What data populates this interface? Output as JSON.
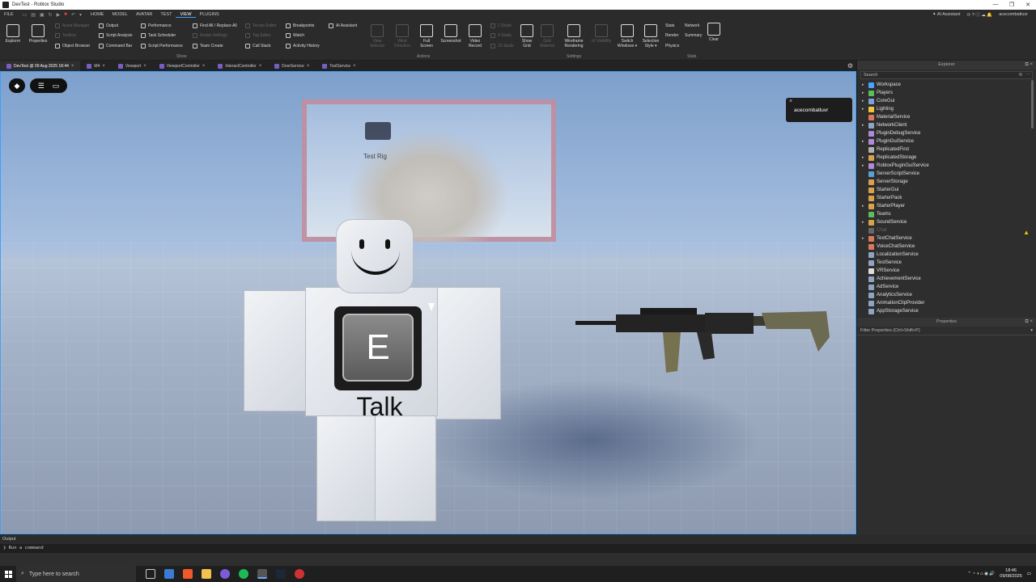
{
  "window": {
    "title": "DevTest - Roblox Studio",
    "controls": [
      "—",
      "❐",
      "✕"
    ]
  },
  "menu": {
    "items": [
      "FILE",
      "HOME",
      "MODEL",
      "AVATAR",
      "TEST",
      "VIEW",
      "PLUGINS"
    ],
    "active": "VIEW",
    "right": {
      "assistant": "AI Assistant",
      "user": "acecombatluvr"
    }
  },
  "ribbon": {
    "big": [
      {
        "label": "Explorer",
        "disabled": false
      },
      {
        "label": "Properties",
        "disabled": false
      }
    ],
    "col1": [
      {
        "label": "Asset Manager",
        "disabled": true
      },
      {
        "label": "Toolbox",
        "disabled": true
      },
      {
        "label": "Object Browser",
        "disabled": false
      }
    ],
    "col2": [
      {
        "label": "Output",
        "disabled": false
      },
      {
        "label": "Script Analysis",
        "disabled": false
      },
      {
        "label": "Command Bar",
        "disabled": false
      }
    ],
    "col3": [
      {
        "label": "Performance",
        "disabled": false
      },
      {
        "label": "Task Scheduler",
        "disabled": false
      },
      {
        "label": "Script Performance",
        "disabled": false
      }
    ],
    "col4": [
      {
        "label": "Find All / Replace All",
        "disabled": false
      },
      {
        "label": "Avatar Settings",
        "disabled": true
      },
      {
        "label": "Team Create",
        "disabled": false
      }
    ],
    "col5": [
      {
        "label": "Terrain Editor",
        "disabled": true
      },
      {
        "label": "Tag Editor",
        "disabled": true
      },
      {
        "label": "Call Stack",
        "disabled": false
      }
    ],
    "col6": [
      {
        "label": "Breakpoints",
        "disabled": false
      },
      {
        "label": "Watch",
        "disabled": false
      },
      {
        "label": "Activity History",
        "disabled": false
      }
    ],
    "col7": [
      {
        "label": "AI Assistant",
        "disabled": false
      }
    ],
    "show_group": "Show",
    "actions": [
      {
        "l1": "View",
        "l2": "Selector",
        "disabled": true
      },
      {
        "l1": "Wind",
        "l2": "Direction",
        "disabled": true
      },
      {
        "l1": "Full",
        "l2": "Screen",
        "disabled": false
      },
      {
        "l1": "Screenshot",
        "l2": "",
        "disabled": false
      },
      {
        "l1": "Video",
        "l2": "Record",
        "disabled": false
      }
    ],
    "studs": [
      "2 Studs",
      "4 Studs",
      "16 Studs"
    ],
    "actions_group": "Actions",
    "settings": [
      {
        "l1": "Show",
        "l2": "Grid",
        "disabled": false
      },
      {
        "l1": "Grid",
        "l2": "Material",
        "disabled": true
      },
      {
        "l1": "Wireframe",
        "l2": "Rendering",
        "disabled": false
      },
      {
        "l1": "UI Visibility",
        "l2": "",
        "disabled": true
      },
      {
        "l1": "Switch",
        "l2": "Windows ▾",
        "disabled": false
      },
      {
        "l1": "Selection",
        "l2": "Style ▾",
        "disabled": false
      }
    ],
    "settings_group": "Settings",
    "stats": [
      "Stats",
      "Render",
      "Physics"
    ],
    "stats2": [
      "Network",
      "Summary"
    ],
    "clear": "Clear",
    "stats_group": "Stats"
  },
  "tabs": [
    {
      "label": "DevTest @ 09 Aug 2025 18:44",
      "active": true
    },
    {
      "label": "M4",
      "active": false
    },
    {
      "label": "Viewport",
      "active": false
    },
    {
      "label": "ViewportController",
      "active": false
    },
    {
      "label": "InteractController",
      "active": false
    },
    {
      "label": "DoorService",
      "active": false
    },
    {
      "label": "ToolService",
      "active": false
    }
  ],
  "viewport": {
    "rig_label": "Test Rig",
    "prompt_key": "E",
    "prompt_action": "Talk",
    "player_tag": "acecombatluvr"
  },
  "explorer": {
    "title": "Explorer",
    "search_placeholder": "Search",
    "items": [
      {
        "label": "Workspace",
        "expand": true,
        "color": "#4aa3ff"
      },
      {
        "label": "Players",
        "expand": true,
        "color": "#5bbd5b"
      },
      {
        "label": "CoreGui",
        "expand": true,
        "color": "#7aa2d8"
      },
      {
        "label": "Lighting",
        "expand": true,
        "color": "#f0c43c"
      },
      {
        "label": "MaterialService",
        "expand": false,
        "color": "#d87a5a"
      },
      {
        "label": "NetworkClient",
        "expand": true,
        "color": "#8fa4c2"
      },
      {
        "label": "PluginDebugService",
        "expand": false,
        "color": "#b08ad8"
      },
      {
        "label": "PluginGuiService",
        "expand": true,
        "color": "#b08ad8"
      },
      {
        "label": "ReplicatedFirst",
        "expand": false,
        "color": "#b0b0b0"
      },
      {
        "label": "ReplicatedStorage",
        "expand": true,
        "color": "#d8a24a"
      },
      {
        "label": "RobloxPluginGuiService",
        "expand": true,
        "color": "#b08ad8"
      },
      {
        "label": "ServerScriptService",
        "expand": false,
        "color": "#5aa0d8"
      },
      {
        "label": "ServerStorage",
        "expand": false,
        "color": "#d8a24a"
      },
      {
        "label": "StarterGui",
        "expand": false,
        "color": "#d8a24a"
      },
      {
        "label": "StarterPack",
        "expand": false,
        "color": "#d8a24a"
      },
      {
        "label": "StarterPlayer",
        "expand": true,
        "color": "#d8a24a"
      },
      {
        "label": "Teams",
        "expand": false,
        "color": "#5bbd5b"
      },
      {
        "label": "SoundService",
        "expand": true,
        "color": "#d8a24a"
      },
      {
        "label": "Chat",
        "expand": false,
        "color": "#666666",
        "dim": true
      },
      {
        "label": "TextChatService",
        "expand": true,
        "color": "#d87a5a"
      },
      {
        "label": "VoiceChatService",
        "expand": false,
        "color": "#d87a5a"
      },
      {
        "label": "LocalizationService",
        "expand": false,
        "color": "#8fa4c2"
      },
      {
        "label": "TestService",
        "expand": false,
        "color": "#8fa4c2"
      },
      {
        "label": "VRService",
        "expand": false,
        "color": "#dddddd"
      },
      {
        "label": "AchievementService",
        "expand": false,
        "color": "#8fa4c2"
      },
      {
        "label": "AdService",
        "expand": false,
        "color": "#8fa4c2"
      },
      {
        "label": "AnalyticsService",
        "expand": false,
        "color": "#8fa4c2"
      },
      {
        "label": "AnimationClipProvider",
        "expand": false,
        "color": "#8fa4c2"
      },
      {
        "label": "AppStorageService",
        "expand": false,
        "color": "#8fa4c2"
      }
    ]
  },
  "properties": {
    "title": "Properties",
    "filter_placeholder": "Filter Properties (Ctrl+Shift+P)"
  },
  "output": {
    "title": "Output"
  },
  "command": {
    "prompt": "Run a command"
  },
  "taskbar": {
    "search_placeholder": "Type here to search",
    "time": "18:46",
    "date": "09/08/2025"
  }
}
